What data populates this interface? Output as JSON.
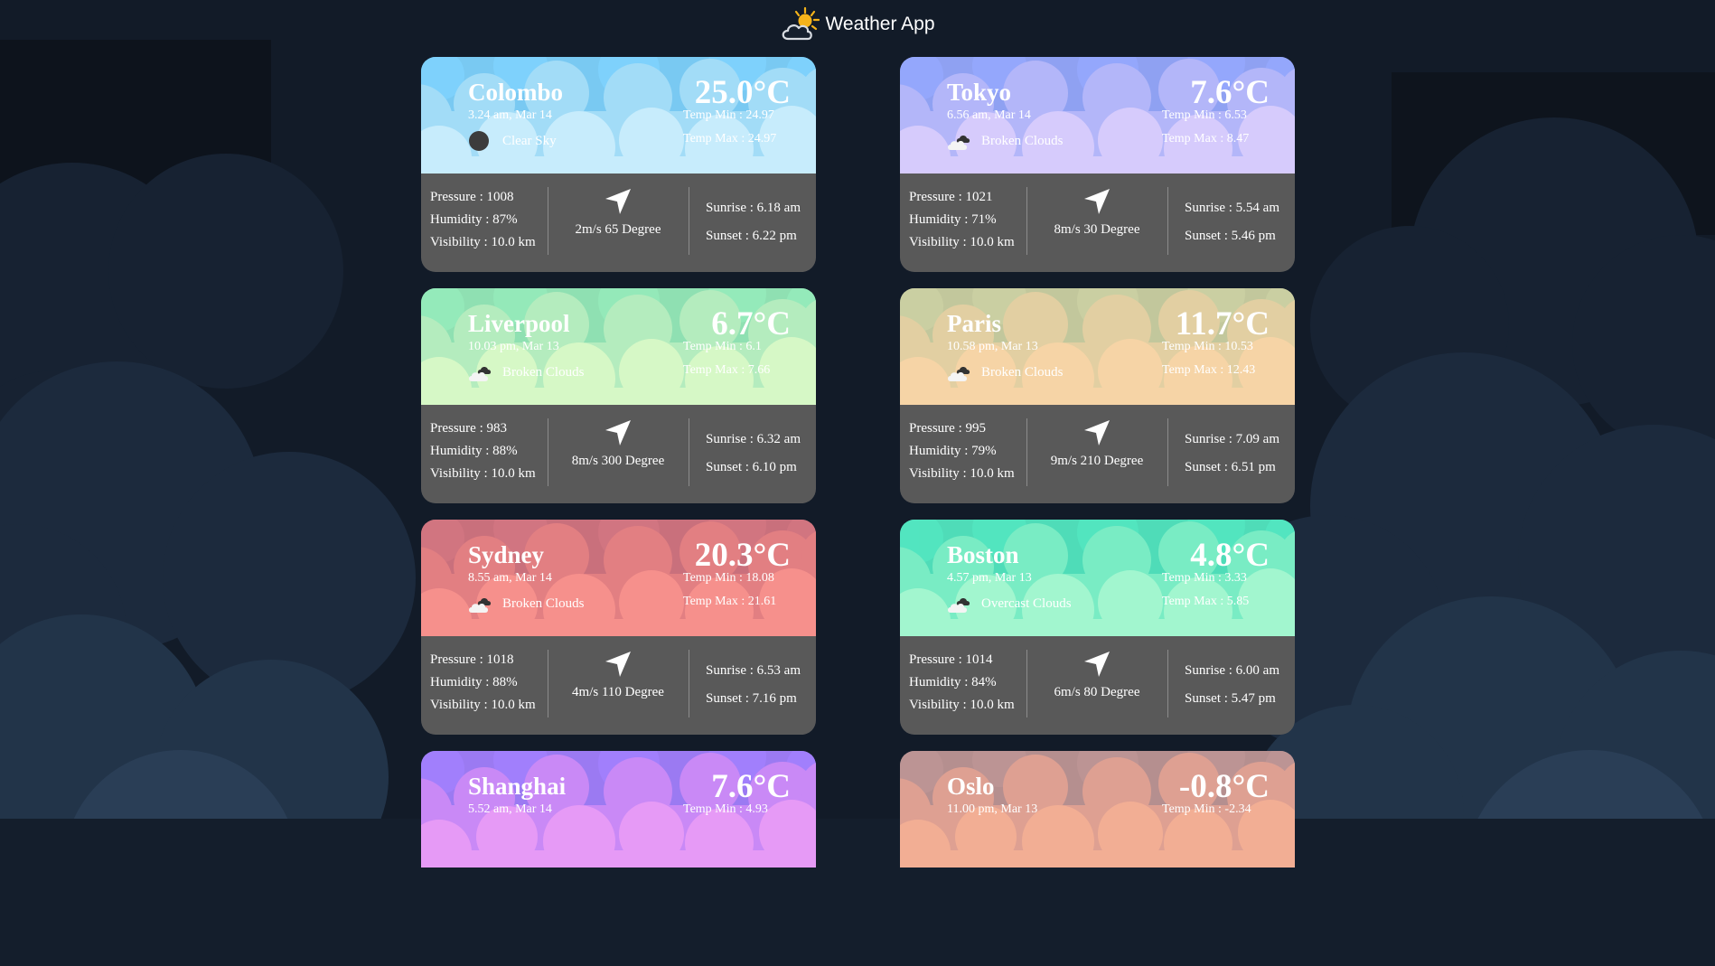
{
  "app": {
    "title": "Weather App",
    "logo_icon": "sun-behind-cloud-icon"
  },
  "cards": [
    {
      "city": "Colombo",
      "time": "3.24 am, Mar 14",
      "condition": "Clear Sky",
      "condition_icon": "dark-circle-icon",
      "temp": "25.0°C",
      "temp_min": "Temp Min : 24.97",
      "temp_max": "Temp Max : 24.97",
      "pressure": "Pressure : 1008",
      "humidity": "Humidity : 87%",
      "visibility": "Visibility : 10.0 km",
      "wind": "2m/s 65 Degree",
      "sunrise": "Sunrise : 6.18 am",
      "sunset": "Sunset : 6.22 pm",
      "colors": {
        "back": "#79c9f2",
        "mid": "#a2dcf7",
        "front": "#c7ecfc"
      }
    },
    {
      "city": "Tokyo",
      "time": "6.56 am, Mar 14",
      "condition": "Broken Clouds",
      "condition_icon": "broken-clouds-icon",
      "temp": "7.6°C",
      "temp_min": "Temp Min : 6.53",
      "temp_max": "Temp Max : 8.47",
      "pressure": "Pressure : 1021",
      "humidity": "Humidity : 71%",
      "visibility": "Visibility : 10.0 km",
      "wind": "8m/s 30 Degree",
      "sunrise": "Sunrise : 5.54 am",
      "sunset": "Sunset : 5.46 pm",
      "colors": {
        "back": "#8fa1f2",
        "mid": "#b3b6f9",
        "front": "#d6cbfc"
      }
    },
    {
      "city": "Liverpool",
      "time": "10.03 pm, Mar 13",
      "condition": "Broken Clouds",
      "condition_icon": "broken-clouds-icon",
      "temp": "6.7°C",
      "temp_min": "Temp Min : 6.1",
      "temp_max": "Temp Max : 7.66",
      "pressure": "Pressure : 983",
      "humidity": "Humidity : 88%",
      "visibility": "Visibility : 10.0 km",
      "wind": "8m/s 300 Degree",
      "sunrise": "Sunrise : 6.32 am",
      "sunset": "Sunset : 6.10 pm",
      "colors": {
        "back": "#8fe0b2",
        "mid": "#b4ecbe",
        "front": "#d6f8c6"
      }
    },
    {
      "city": "Paris",
      "time": "10.58 pm, Mar 13",
      "condition": "Broken Clouds",
      "condition_icon": "broken-clouds-icon",
      "temp": "11.7°C",
      "temp_min": "Temp Min : 10.53",
      "temp_max": "Temp Max : 12.43",
      "pressure": "Pressure : 995",
      "humidity": "Humidity : 79%",
      "visibility": "Visibility : 10.0 km",
      "wind": "9m/s 210 Degree",
      "sunrise": "Sunrise : 7.09 am",
      "sunset": "Sunset : 6.51 pm",
      "colors": {
        "back": "#c2c79c",
        "mid": "#e2cfa2",
        "front": "#f6d4a6"
      }
    },
    {
      "city": "Sydney",
      "time": "8.55 am, Mar 14",
      "condition": "Broken Clouds",
      "condition_icon": "broken-clouds-icon",
      "temp": "20.3°C",
      "temp_min": "Temp Min : 18.08",
      "temp_max": "Temp Max : 21.61",
      "pressure": "Pressure : 1018",
      "humidity": "Humidity : 88%",
      "visibility": "Visibility : 10.0 km",
      "wind": "4m/s 110 Degree",
      "sunrise": "Sunrise : 6.53 am",
      "sunset": "Sunset : 7.16 pm",
      "colors": {
        "back": "#c9707c",
        "mid": "#e27f82",
        "front": "#f6908c"
      }
    },
    {
      "city": "Boston",
      "time": "4.57 pm, Mar 13",
      "condition": "Overcast Clouds",
      "condition_icon": "broken-clouds-icon",
      "temp": "4.8°C",
      "temp_min": "Temp Min : 3.33",
      "temp_max": "Temp Max : 5.85",
      "pressure": "Pressure : 1014",
      "humidity": "Humidity : 84%",
      "visibility": "Visibility : 10.0 km",
      "wind": "6m/s 80 Degree",
      "sunrise": "Sunrise : 6.00 am",
      "sunset": "Sunset : 5.47 pm",
      "colors": {
        "back": "#4fdcb8",
        "mid": "#79ecc4",
        "front": "#a2f6cf"
      }
    },
    {
      "city": "Shanghai",
      "time": "5.52 am, Mar 14",
      "temp": "7.6°C",
      "temp_min": "Temp Min : 4.93",
      "colors": {
        "back": "#9b7af2",
        "mid": "#c989f6",
        "front": "#e69af6"
      }
    },
    {
      "city": "Oslo",
      "time": "11.00 pm, Mar 13",
      "temp": "-0.8°C",
      "temp_min": "Temp Min : -2.34",
      "colors": {
        "back": "#b58f8f",
        "mid": "#dea092",
        "front": "#f2ae94"
      }
    }
  ]
}
